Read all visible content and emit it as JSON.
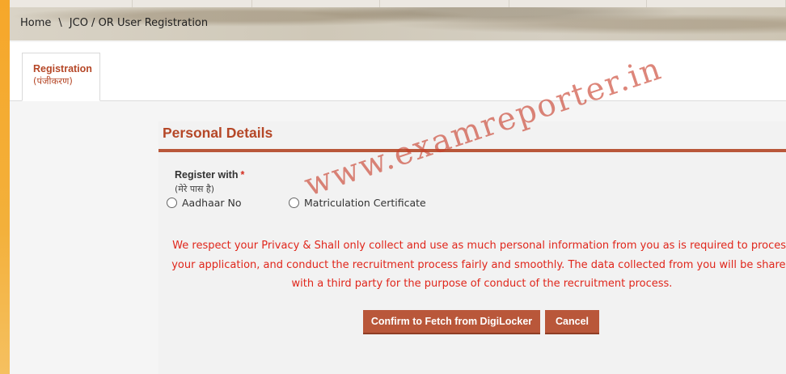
{
  "breadcrumb": {
    "home": "Home",
    "separator": "\\",
    "current": "JCO / OR User Registration"
  },
  "tab": {
    "label": "Registration",
    "label_hindi": "(पंजीकरण)"
  },
  "panel": {
    "title": "Personal Details"
  },
  "register_with": {
    "label": "Register with",
    "required_mark": "*",
    "label_hindi": "(मेरे पास है)",
    "options": [
      {
        "label": "Aadhaar No",
        "selected": false
      },
      {
        "label": "Matriculation Certificate",
        "selected": false
      }
    ]
  },
  "privacy_notice": "We respect your Privacy & Shall only collect and use as much personal information from you as is required to process your application, and conduct the recruitment process fairly and smoothly. The data collected from you will be shared with a third party for the purpose of conduct of the recruitment process.",
  "buttons": {
    "confirm": "Confirm to Fetch from DigiLocker",
    "cancel": "Cancel"
  },
  "watermark": "www.examreporter.in",
  "colors": {
    "accent": "#b9573a",
    "title": "#b54727",
    "notice": "#e0261b",
    "stripe": "#f6a72a"
  }
}
